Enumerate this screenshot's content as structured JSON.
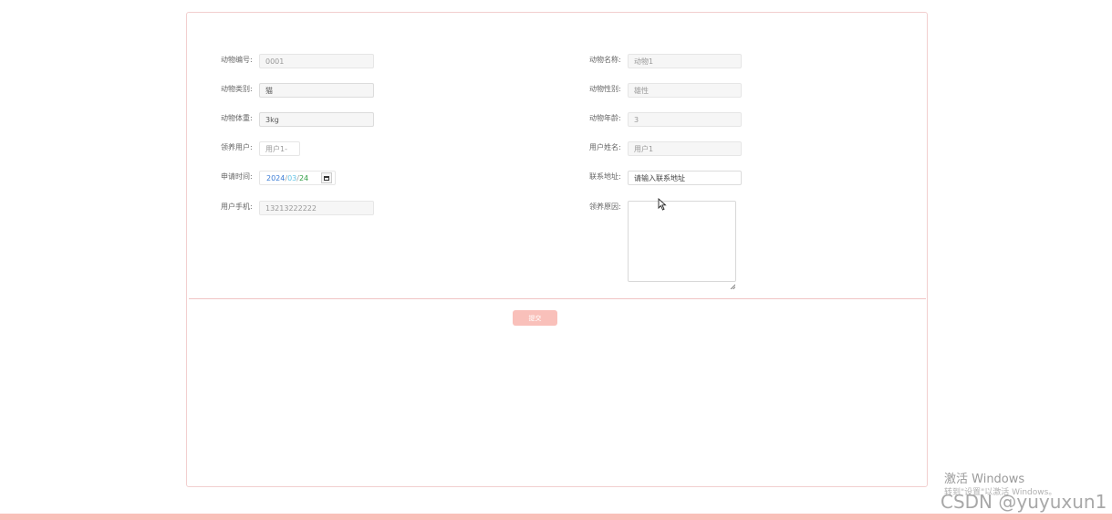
{
  "form": {
    "animal_id": {
      "label": "动物编号:",
      "value": "0001"
    },
    "animal_name": {
      "label": "动物名称:",
      "value": "动物1"
    },
    "animal_type": {
      "label": "动物类别:",
      "value": "猫"
    },
    "animal_gender": {
      "label": "动物性别:",
      "value": "雄性"
    },
    "animal_weight": {
      "label": "动物体重:",
      "value": "3kg"
    },
    "animal_age": {
      "label": "动物年龄:",
      "value": "3"
    },
    "adopt_user": {
      "label": "领养用户:",
      "value": "用户1-"
    },
    "user_name": {
      "label": "用户姓名:",
      "value": "用户1"
    },
    "apply_time": {
      "label": "申请时间:",
      "year": "2024",
      "month": "03",
      "day": "24",
      "sep": "/"
    },
    "contact_address": {
      "label": "联系地址:",
      "placeholder": "请输入联系地址"
    },
    "user_phone": {
      "label": "用户手机:",
      "value": "13213222222"
    },
    "adopt_reason": {
      "label": "领养原因:",
      "value": ""
    }
  },
  "submit_label": "提交",
  "watermark": {
    "title": "激活 Windows",
    "subtitle": "转到\"设置\"以激活 Windows。"
  },
  "csdn_mark": "CSDN @yuyuxun1",
  "colors": {
    "accent": "#f9c0ba",
    "border": "#f2cfcf"
  }
}
